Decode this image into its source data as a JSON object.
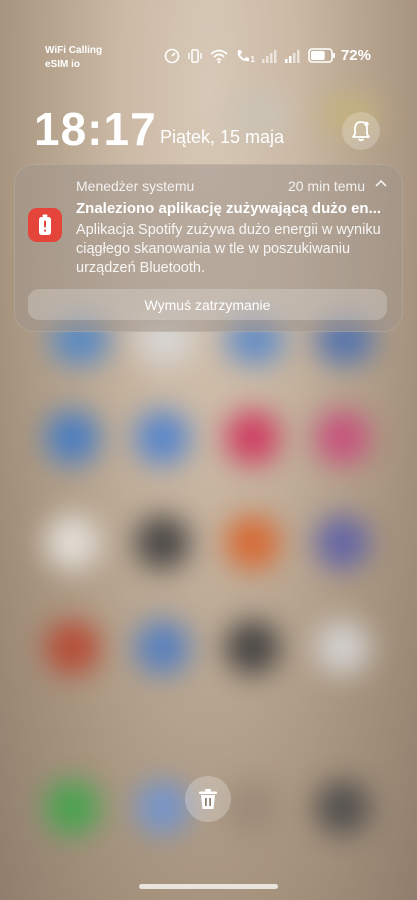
{
  "status_bar": {
    "carrier_line1": "WiFi Calling",
    "carrier_line2": "eSIM io",
    "wifi_call_sub": "1",
    "battery_percent": "72%",
    "battery_level": 0.72
  },
  "lockscreen": {
    "time": "18:17",
    "date": "Piątek, 15 maja"
  },
  "notification": {
    "app_name": "Menedżer systemu",
    "time_ago": "20 min temu",
    "title": "Znaleziono aplikację zużywającą dużo en...",
    "body": "Aplikacja Spotify zużywa dużo energii w wyniku ciągłego skanowania w tle w poszukiwaniu urządzeń Bluetooth.",
    "action_label": "Wymuś zatrzymanie",
    "icon": "battery-warning-icon",
    "accent_color": "#e5443b"
  },
  "icons": {
    "bell": "bell-icon",
    "trash": "trash-icon"
  }
}
